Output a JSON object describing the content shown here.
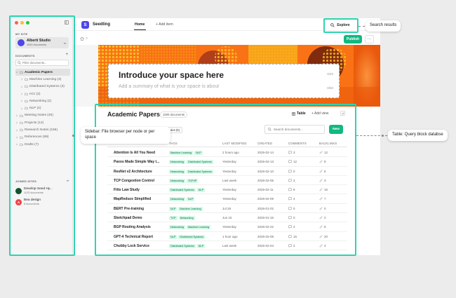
{
  "colors": {
    "accent": "#10b981",
    "brand": "#4f46e5",
    "highlight": "#2dd4b0"
  },
  "sidebar": {
    "my_site_label": "MY SITE",
    "site": {
      "name": "Alberti Studio",
      "sub": "1000 documents"
    },
    "documents_label": "DOCUMENTS",
    "add_label": "+",
    "filter_placeholder": "Filter documents...",
    "tree": [
      {
        "label": "Academic Papers",
        "level": 0,
        "expanded": true,
        "active": true
      },
      {
        "label": "Machine Learning (4)",
        "level": 1
      },
      {
        "label": "Distributed Systems (3)",
        "level": 1
      },
      {
        "label": "HCI (2)",
        "level": 1
      },
      {
        "label": "Networking (2)",
        "level": 1
      },
      {
        "label": "NLP (2)",
        "level": 1
      },
      {
        "label": "Meeting Notes (45)",
        "level": 0
      },
      {
        "label": "Projects (12)",
        "level": 0
      },
      {
        "label": "Research Notes (156)",
        "level": 0
      },
      {
        "label": "References (89)",
        "level": 0
      },
      {
        "label": "Drafts (7)",
        "level": 0
      }
    ],
    "joined_label": "JOINED SITES",
    "joined": [
      {
        "name": "Develop Seed Hy...",
        "sub": "1123 documents",
        "initial": "",
        "color": "#14532d"
      },
      {
        "name": "Bea design",
        "sub": "8 documents",
        "initial": "A",
        "color": "#ef4444"
      }
    ]
  },
  "topbar": {
    "logo_letter": "S",
    "app_title": "Seedling",
    "tab_home": "Home",
    "tab_add": "+ Add item",
    "explore": "Explore"
  },
  "page": {
    "crumb_sep": ">",
    "publish": "Publish",
    "more": "···",
    "hero_title": "Introduce your space here",
    "hero_title_count": "0/40",
    "hero_subtitle": "Add a summary of what is your space is about",
    "hero_subtitle_count": "0/60"
  },
  "table": {
    "title": "Academic Papers",
    "badge": "1000 documents",
    "view_label": "Table",
    "add_view": "+ Add view",
    "filter_pill": "des (6)",
    "search_placeholder": "Search documents...",
    "new_label": "New",
    "headers": [
      "TAGS",
      "LAST MODIFIED",
      "CREATED",
      "COMMENTS",
      "BACKLINKS"
    ],
    "rows": [
      {
        "name": "Attention Is All You Need",
        "tags": [
          "Machine Learning",
          "NLP"
        ],
        "modified": "2 hours ago",
        "created": "2026-02-14",
        "comments": "3",
        "backlinks": "12"
      },
      {
        "name": "Paxos Made Simple Way t...",
        "tags": [
          "Networking",
          "Distributed Systems"
        ],
        "modified": "Yesterday",
        "created": "2026-02-13",
        "comments": "12",
        "backlinks": "8"
      },
      {
        "name": "ResNet v2 Architecture",
        "tags": [
          "Networking",
          "Distributed Systems"
        ],
        "modified": "Yesterday",
        "created": "2026-02-10",
        "comments": "0",
        "backlinks": "5"
      },
      {
        "name": "TCP Congestion Control",
        "tags": [
          "Networking",
          "TCP/IP"
        ],
        "modified": "Last week",
        "created": "2026-02-05",
        "comments": "2",
        "backlinks": "3"
      },
      {
        "name": "Fitts Law Study",
        "tags": [
          "Distributed Systems",
          "NLP"
        ],
        "modified": "Yesterday",
        "created": "2026-02-11",
        "comments": "8",
        "backlinks": "15"
      },
      {
        "name": "MapReduce Simplified",
        "tags": [
          "Networking",
          "NLP"
        ],
        "modified": "Yesterday",
        "created": "2026-02-09",
        "comments": "4",
        "backlinks": "7"
      },
      {
        "name": "BERT Pre-training",
        "tags": [
          "NLP",
          "Machine Learning"
        ],
        "modified": "Jul 28",
        "created": "2026-01-02",
        "comments": "0",
        "backlinks": "0"
      },
      {
        "name": "Sketchpad Demo",
        "tags": [
          "TCP",
          "Networking"
        ],
        "modified": "Jun 15",
        "created": "2026-01-15",
        "comments": "0",
        "backlinks": "2"
      },
      {
        "name": "BGP Routing Analysis",
        "tags": [
          "Networking",
          "Machine Learning"
        ],
        "modified": "Yesterday",
        "created": "2026-02-22",
        "comments": "4",
        "backlinks": "6"
      },
      {
        "name": "GPT-4 Technical Report",
        "tags": [
          "NLP",
          "Distributed Systems"
        ],
        "modified": "1 hour ago",
        "created": "2026-02-09",
        "comments": "15",
        "backlinks": "20"
      },
      {
        "name": "Chubby Lock Service",
        "tags": [
          "Distributed Systems",
          "NLP"
        ],
        "modified": "Last week",
        "created": "2026-02-04",
        "comments": "2",
        "backlinks": "4"
      }
    ]
  },
  "annotations": {
    "search_results": "Search results",
    "sidebar_note": "Sidebar: File browser per node or per space",
    "table_note": "Table: Query block databse"
  }
}
